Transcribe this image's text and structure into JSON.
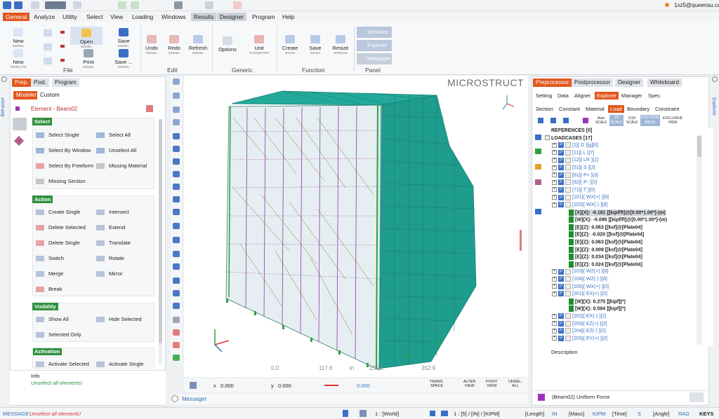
{
  "user": "1xz5@queensu.ca",
  "menu": [
    "General",
    "Analyze",
    "Utility",
    "Select",
    "View",
    "Loading",
    "Windows",
    "Results",
    "Designer",
    "Program",
    "Help"
  ],
  "ribbon": {
    "file": {
      "group": "File",
      "new_model": "New",
      "new_model_sub": "MODEL",
      "new_template": "New",
      "new_template_sub": "TEMPLATE",
      "open": "Open",
      "open_sub": "MODEL",
      "print": "Print",
      "print_sub": "MODEL",
      "save": "Save",
      "save_sub": "MODEL",
      "save_as": "Save ...",
      "save_as_sub": "MODEL"
    },
    "edit": {
      "group": "Edit",
      "undo": "Undo",
      "undo_sub": "MODEL",
      "redo": "Redo",
      "redo_sub": "MODEL",
      "refresh": "Refresh",
      "refresh_sub": "MODEL"
    },
    "generic": {
      "group": "Generic",
      "options": "Options",
      "unit": "Unit",
      "unit_sub": "CONVERTER"
    },
    "function": {
      "group": "Function",
      "create": "Create",
      "create_sub": "IMAGE",
      "save": "Save",
      "save_sub": "IMAGE",
      "resize": "Resize",
      "resize_sub": "WINDOW"
    },
    "panel": {
      "group": "Panel",
      "behavior": "Behavior",
      "explorer": "Explorer",
      "messager": "Messager"
    }
  },
  "side_left": "Behavior",
  "side_right": "Explorer",
  "left": {
    "tabs": [
      "Prep.",
      "Post.",
      "Program"
    ],
    "subtabs": [
      "Modeler",
      "Custom"
    ],
    "element_title": "Element - Beam02",
    "select": {
      "title": "Select",
      "items": [
        "Select Single",
        "Select All",
        "Select By Window",
        "Unselect All",
        "Select By Freeform",
        "Missing Material",
        "Missing Section"
      ]
    },
    "action": {
      "title": "Action",
      "items": [
        "Create Single",
        "Intersect",
        "Delete Selected",
        "Extend",
        "Delete Single",
        "Translate",
        "Switch",
        "Rotate",
        "Merge",
        "Mirror",
        "Break"
      ]
    },
    "visibility": {
      "title": "Visibility",
      "items": [
        "Show All",
        "Hide Selected",
        "Selected Only"
      ]
    },
    "activation": {
      "title": "Activation",
      "items": [
        "Activate Selected",
        "Activate Single"
      ]
    },
    "info_label": "Info",
    "info_text": "Unselect all elements!"
  },
  "viewport": {
    "title": "MICROSTRUCT",
    "ruler": [
      "0.0",
      "117.6",
      "in",
      "235.2",
      "352.9"
    ],
    "status": {
      "x_label": "x",
      "x": "0.000",
      "y_label": "y",
      "y": "0.000",
      "z": "0.000",
      "trans": "TRANS.",
      "trans_sub": "SPACE",
      "alter": "ALTER",
      "alter_sub": "VIEW",
      "pivot": "PIVOT",
      "pivot_sub": "VIEW",
      "unsel": "UNSEL.",
      "unsel_sub": "ALL"
    },
    "messager": "Messager"
  },
  "right": {
    "tabs": [
      "Preprocessor",
      "Postprocessor",
      "Designer",
      "Whiteboard"
    ],
    "row2": [
      "Setting",
      "Data",
      "Aligner",
      "Explorer",
      "Manager",
      "Spec."
    ],
    "row3": [
      "Section",
      "Constant",
      "Material",
      "Load",
      "Boundary",
      "Constraint"
    ],
    "toolbar": {
      "auto": "Auto",
      "auto_sub": "SCALE",
      "one": "1X",
      "one_sub": "SCALE",
      "half": "0.5X",
      "half_sub": "SCALE",
      "polygon": "POLYGON",
      "polygon_sub": "MESH",
      "exclusive": "EXCLUSIVE",
      "exclusive_sub": "VIEW"
    },
    "tree": [
      {
        "indent": 0,
        "text": "REFERENCES [0]",
        "kind": "head"
      },
      {
        "indent": 0,
        "text": "LOADCASES [17]",
        "kind": "head"
      },
      {
        "indent": 1,
        "text": "[1]{ D }[g][6]",
        "kind": "case"
      },
      {
        "indent": 1,
        "text": "[11]{ L }[7]",
        "kind": "case"
      },
      {
        "indent": 1,
        "text": "[12]{ LR }[1]",
        "kind": "case"
      },
      {
        "indent": 1,
        "text": "[51]{ S }[2]",
        "kind": "case"
      },
      {
        "indent": 1,
        "text": "[61]{ P+ }[3]",
        "kind": "case"
      },
      {
        "indent": 1,
        "text": "[62]{ P- }[3]",
        "kind": "case"
      },
      {
        "indent": 1,
        "text": "[71]{ T }[0]",
        "kind": "case"
      },
      {
        "indent": 1,
        "text": "[101]{ WX(+) }[8]",
        "kind": "case"
      },
      {
        "indent": 1,
        "text": "[102]{ WX(-) }[8]",
        "kind": "case"
      },
      {
        "indent": 2,
        "text": "[X]{X}: -0.181 [[kipf/ft]@[0.00*1.00*]-(m)",
        "kind": "load"
      },
      {
        "indent": 2,
        "text": "[W]{X}: -0.090 [[kipf/ft]@[0.00*1.00*]-(m)",
        "kind": "load"
      },
      {
        "indent": 2,
        "text": "[E]{Z}: 0.063 [[ksf]@[Plate04]",
        "kind": "load"
      },
      {
        "indent": 2,
        "text": "[E]{Z}: -0.020 [[ksf]@[Plate04]",
        "kind": "load"
      },
      {
        "indent": 2,
        "text": "[E]{Z}: 0.063 [[ksf]@[Plate04]",
        "kind": "load"
      },
      {
        "indent": 2,
        "text": "[E]{Z}: 0.009 [[ksf]@[Plate04]",
        "kind": "load"
      },
      {
        "indent": 2,
        "text": "[E]{Z}: 0.034 [[ksf]@[Plate04]",
        "kind": "load"
      },
      {
        "indent": 2,
        "text": "[E]{Z}: 0.024 [[ksf]@[Plate04]",
        "kind": "load"
      },
      {
        "indent": 1,
        "text": "[103]{ WZ(+) }[8]",
        "kind": "case"
      },
      {
        "indent": 1,
        "text": "[104]{ WZ(-) }[8]",
        "kind": "case"
      },
      {
        "indent": 1,
        "text": "[105]{ WX(+) }[0]",
        "kind": "case"
      },
      {
        "indent": 1,
        "text": "[201]{ EX(+) }[2]",
        "kind": "case"
      },
      {
        "indent": 2,
        "text": "[W]{X}: 0.275 ][kipf](*)",
        "kind": "load"
      },
      {
        "indent": 2,
        "text": "[W]{X}: 0.594 ][kipf](*)",
        "kind": "load"
      },
      {
        "indent": 1,
        "text": "[202]{ EX(-) }[2]",
        "kind": "case"
      },
      {
        "indent": 1,
        "text": "[203]{ EZ(+) }[2]",
        "kind": "case"
      },
      {
        "indent": 1,
        "text": "[204]{ EZ(-) }[2]",
        "kind": "case"
      },
      {
        "indent": 1,
        "text": "[205]{ EY(+) }[2]",
        "kind": "case"
      }
    ],
    "description_label": "Description",
    "footer": "(Beam02) Uniform Force"
  },
  "statusbar": {
    "message_label": "MESSAGE:",
    "message": "Unselect all elements!",
    "world": "1 : [World]",
    "units": "1 : [5] / [IN] / [KIPM]",
    "length": "[Length]",
    "length_v": "IN",
    "mass": "[Mass]",
    "mass_v": "KIPM",
    "time": "[Time]",
    "time_v": "S",
    "angle": "[Angle]",
    "angle_v": "RAD",
    "keys": "KEYS"
  }
}
